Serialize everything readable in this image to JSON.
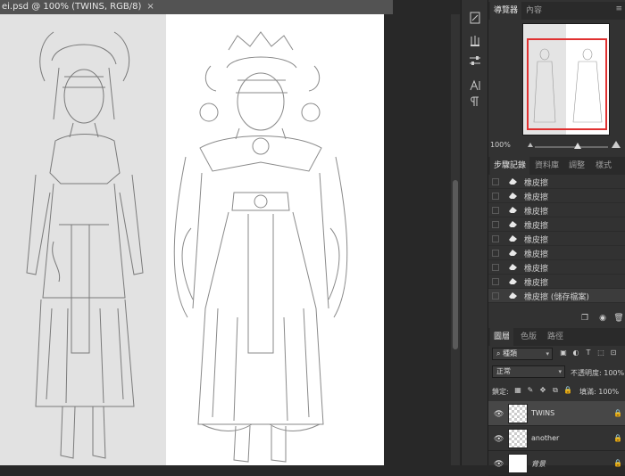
{
  "document": {
    "tab_title": "ei.psd @ 100% (TWINS, RGB/8)",
    "close_glyph": "×"
  },
  "toolstrip": {
    "icons": [
      "brush-preset-icon",
      "brush-settings-icon",
      "adjustment-sliders-icon",
      "character-icon",
      "paragraph-icon"
    ]
  },
  "navigator": {
    "tabs": [
      "導覽器",
      "內容"
    ],
    "zoom": "100%"
  },
  "history": {
    "tabs": [
      "步驟記錄",
      "資料庫",
      "調整",
      "樣式"
    ],
    "items": [
      "橡皮擦",
      "橡皮擦",
      "橡皮擦",
      "橡皮擦",
      "橡皮擦",
      "橡皮擦",
      "橡皮擦",
      "橡皮擦",
      "橡皮擦 (儲存檔案)"
    ]
  },
  "layers": {
    "tabs": [
      "圖層",
      "色版",
      "路徑"
    ],
    "kind_filter": "種類",
    "blend_mode": "正常",
    "opacity_label": "不透明度:",
    "opacity_value": "100%",
    "lock_label": "鎖定:",
    "fill_label": "填滿:",
    "fill_value": "100%",
    "items": [
      {
        "name": "TWINS",
        "selected": true
      },
      {
        "name": "another",
        "selected": false
      },
      {
        "name": "背景",
        "selected": false
      }
    ]
  },
  "colors": {
    "accent_red": "#e03030",
    "panel_bg": "#323232",
    "canvas_gray": "#e2e2e2"
  }
}
